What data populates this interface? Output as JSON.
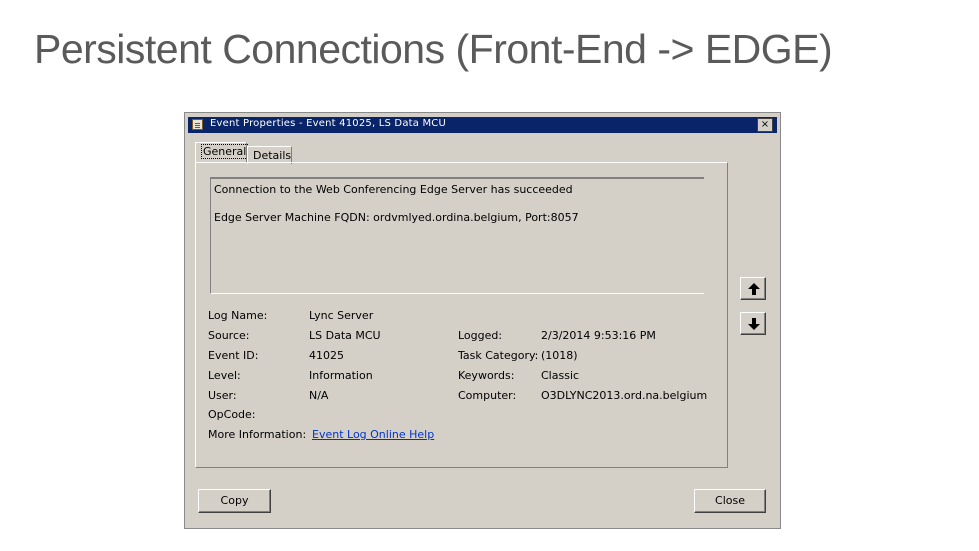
{
  "slide": {
    "title": "Persistent Connections (Front-End -> EDGE)"
  },
  "dialog": {
    "title": "Event Properties - Event 41025, LS Data MCU",
    "close_glyph": "×",
    "tabs": [
      {
        "label": "General"
      },
      {
        "label": "Details"
      }
    ],
    "description": [
      "Connection to the Web Conferencing Edge Server has succeeded",
      "Edge Server Machine FQDN: ordvmlyed.ordina.belgium, Port:8057"
    ],
    "fields_left": [
      {
        "label": "Log Name:",
        "value": "Lync Server"
      },
      {
        "label": "Source:",
        "value": "LS Data MCU"
      },
      {
        "label": "Event ID:",
        "value": "41025"
      },
      {
        "label": "Level:",
        "value": "Information"
      },
      {
        "label": "User:",
        "value": "N/A"
      },
      {
        "label": "OpCode:",
        "value": ""
      },
      {
        "label": "More Information:",
        "value": "Event Log Online Help"
      }
    ],
    "fields_right": [
      {
        "label": "Logged:",
        "value": "2/3/2014 9:53:16 PM"
      },
      {
        "label": "Task Category:",
        "value": "(1018)"
      },
      {
        "label": "Keywords:",
        "value": "Classic"
      },
      {
        "label": "Computer:",
        "value": "O3DLYNC2013.ord.na.belgium"
      }
    ],
    "buttons": {
      "copy": "Copy",
      "close": "Close"
    },
    "colors": {
      "titlebar": "#0a246a",
      "face": "#d4d0c8",
      "link": "#0033cc"
    }
  }
}
